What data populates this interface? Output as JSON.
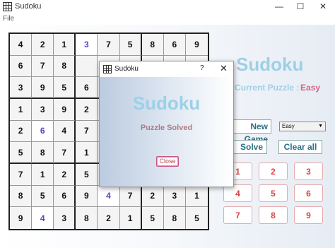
{
  "window": {
    "title": "Sudoku",
    "minimize": "—",
    "maximize": "☐",
    "close": "✕"
  },
  "menu": {
    "file": "File"
  },
  "grid": [
    [
      {
        "v": "4",
        "u": false
      },
      {
        "v": "2",
        "u": false
      },
      {
        "v": "1",
        "u": false
      },
      {
        "v": "3",
        "u": true
      },
      {
        "v": "7",
        "u": false
      },
      {
        "v": "5",
        "u": false
      },
      {
        "v": "8",
        "u": false
      },
      {
        "v": "6",
        "u": false
      },
      {
        "v": "9",
        "u": false
      }
    ],
    [
      {
        "v": "6",
        "u": false
      },
      {
        "v": "7",
        "u": false
      },
      {
        "v": "8",
        "u": false
      },
      {
        "v": "",
        "u": false
      },
      {
        "v": "",
        "u": false
      },
      {
        "v": "",
        "u": false
      },
      {
        "v": "",
        "u": false
      },
      {
        "v": "",
        "u": false
      },
      {
        "v": "",
        "u": false
      }
    ],
    [
      {
        "v": "3",
        "u": false
      },
      {
        "v": "9",
        "u": false
      },
      {
        "v": "5",
        "u": false
      },
      {
        "v": "6",
        "u": false
      },
      {
        "v": "",
        "u": false
      },
      {
        "v": "",
        "u": false
      },
      {
        "v": "",
        "u": false
      },
      {
        "v": "",
        "u": false
      },
      {
        "v": "",
        "u": false
      }
    ],
    [
      {
        "v": "1",
        "u": false
      },
      {
        "v": "3",
        "u": false
      },
      {
        "v": "9",
        "u": false
      },
      {
        "v": "2",
        "u": false
      },
      {
        "v": "",
        "u": false
      },
      {
        "v": "",
        "u": false
      },
      {
        "v": "",
        "u": false
      },
      {
        "v": "",
        "u": false
      },
      {
        "v": "",
        "u": false
      }
    ],
    [
      {
        "v": "2",
        "u": false
      },
      {
        "v": "6",
        "u": true
      },
      {
        "v": "4",
        "u": false
      },
      {
        "v": "7",
        "u": false
      },
      {
        "v": "",
        "u": false
      },
      {
        "v": "",
        "u": false
      },
      {
        "v": "",
        "u": false
      },
      {
        "v": "",
        "u": false
      },
      {
        "v": "",
        "u": false
      }
    ],
    [
      {
        "v": "5",
        "u": false
      },
      {
        "v": "8",
        "u": false
      },
      {
        "v": "7",
        "u": false
      },
      {
        "v": "1",
        "u": false
      },
      {
        "v": "",
        "u": false
      },
      {
        "v": "",
        "u": false
      },
      {
        "v": "",
        "u": false
      },
      {
        "v": "",
        "u": false
      },
      {
        "v": "",
        "u": false
      }
    ],
    [
      {
        "v": "7",
        "u": false
      },
      {
        "v": "1",
        "u": false
      },
      {
        "v": "2",
        "u": false
      },
      {
        "v": "5",
        "u": false
      },
      {
        "v": "",
        "u": false
      },
      {
        "v": "",
        "u": false
      },
      {
        "v": "",
        "u": false
      },
      {
        "v": "",
        "u": false
      },
      {
        "v": "",
        "u": false
      }
    ],
    [
      {
        "v": "8",
        "u": false
      },
      {
        "v": "5",
        "u": false
      },
      {
        "v": "6",
        "u": false
      },
      {
        "v": "9",
        "u": false
      },
      {
        "v": "4",
        "u": true
      },
      {
        "v": "7",
        "u": false
      },
      {
        "v": "2",
        "u": false
      },
      {
        "v": "3",
        "u": false
      },
      {
        "v": "1",
        "u": false
      }
    ],
    [
      {
        "v": "9",
        "u": false
      },
      {
        "v": "4",
        "u": true
      },
      {
        "v": "3",
        "u": false
      },
      {
        "v": "8",
        "u": false
      },
      {
        "v": "2",
        "u": false
      },
      {
        "v": "1",
        "u": false
      },
      {
        "v": "5",
        "u": false
      },
      {
        "v": "8",
        "u": false
      },
      {
        "v": "5",
        "u": false
      }
    ]
  ],
  "panel": {
    "title": "Sudoku",
    "current_label": "Current Puzzle :",
    "current_value": "Easy",
    "new_game": "New Game",
    "difficulty": "Easy",
    "solve": "Solve",
    "clear_all": "Clear all",
    "numpad": [
      "1",
      "2",
      "3",
      "4",
      "5",
      "6",
      "7",
      "8",
      "9"
    ]
  },
  "dialog": {
    "title": "Sudoku",
    "help": "?",
    "close": "✕",
    "heading": "Sudoku",
    "message": "Puzzle Solved",
    "close_button": "Close"
  },
  "colors": {
    "accent": "#9dd0e6",
    "numpad_text": "#d8434a",
    "user_digit": "#5546c9"
  }
}
